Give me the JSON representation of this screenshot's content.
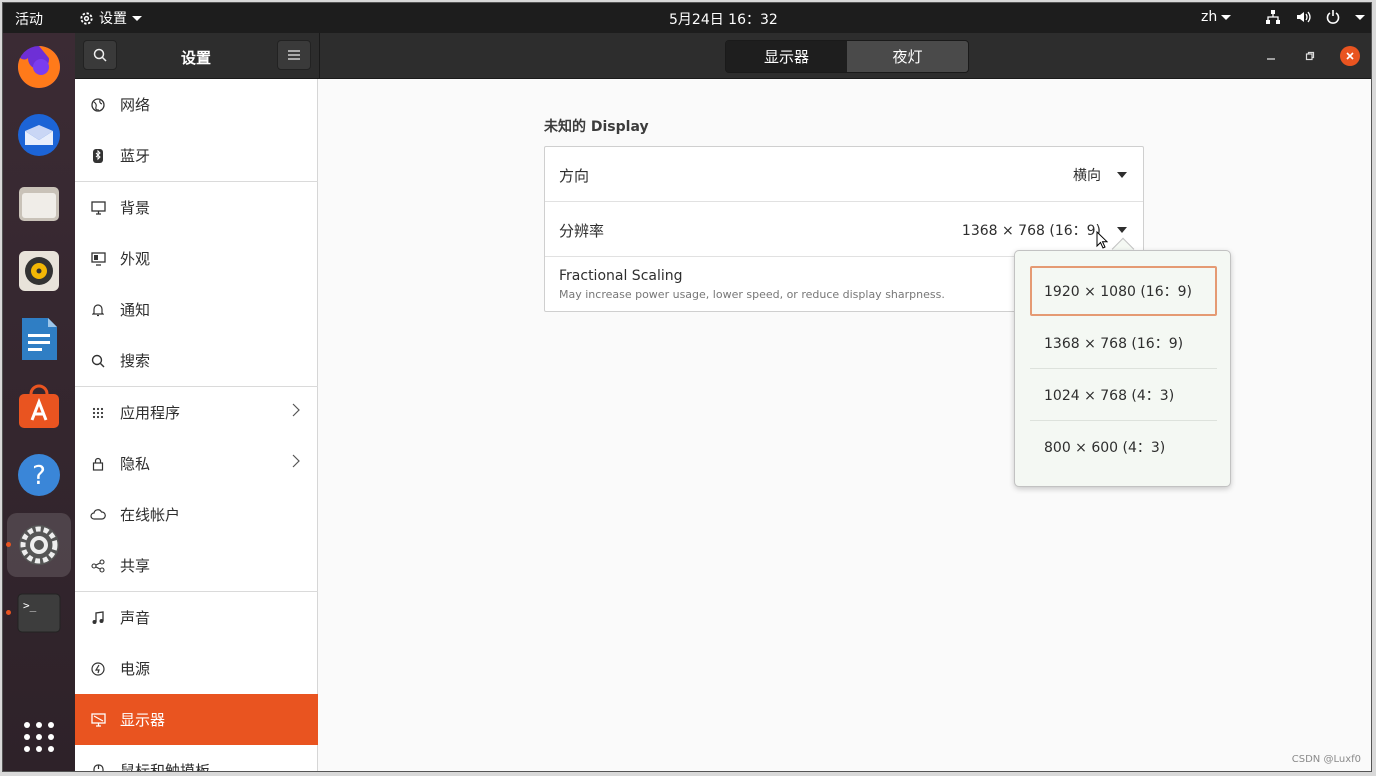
{
  "topbar": {
    "activities": "活动",
    "app_menu": "设置",
    "clock": "5月24日  16：32",
    "lang": "zh"
  },
  "headerbar": {
    "title": "设置",
    "tabs": [
      {
        "label": "显示器",
        "active": true
      },
      {
        "label": "夜灯",
        "active": false
      }
    ]
  },
  "sidebar": {
    "items": [
      {
        "label": "网络",
        "icon": "globe-icon"
      },
      {
        "label": "蓝牙",
        "icon": "bluetooth-icon"
      },
      {
        "label": "背景",
        "icon": "monitor-icon"
      },
      {
        "label": "外观",
        "icon": "appearance-icon"
      },
      {
        "label": "通知",
        "icon": "bell-icon"
      },
      {
        "label": "搜索",
        "icon": "search-icon"
      },
      {
        "label": "应用程序",
        "icon": "grid-icon"
      },
      {
        "label": "隐私",
        "icon": "lock-icon"
      },
      {
        "label": "在线帐户",
        "icon": "cloud-icon"
      },
      {
        "label": "共享",
        "icon": "share-icon"
      },
      {
        "label": "声音",
        "icon": "music-icon"
      },
      {
        "label": "电源",
        "icon": "power-icon"
      },
      {
        "label": "显示器",
        "icon": "display-icon",
        "selected": true
      },
      {
        "label": "鼠标和触摸板",
        "icon": "mouse-icon"
      }
    ]
  },
  "main": {
    "display_title": "未知的 Display",
    "orientation": {
      "label": "方向",
      "value": "横向"
    },
    "resolution": {
      "label": "分辨率",
      "value": "1368 × 768 (16：9)"
    },
    "fractional": {
      "label": "Fractional Scaling",
      "sub": "May increase power usage, lower speed, or reduce display sharpness."
    }
  },
  "popover": {
    "options": [
      {
        "label": "1920 × 1080 (16：9)",
        "selected": true
      },
      {
        "label": "1368 × 768 (16：9)",
        "selected": false
      },
      {
        "label": "1024 × 768 (4：3)",
        "selected": false
      },
      {
        "label": "800 × 600 (4：3)",
        "selected": false
      }
    ]
  },
  "watermark": "CSDN @Luxf0",
  "colors": {
    "accent": "#e95420",
    "topbar": "#1d1d1d",
    "headerbar": "#2d2d2d"
  }
}
